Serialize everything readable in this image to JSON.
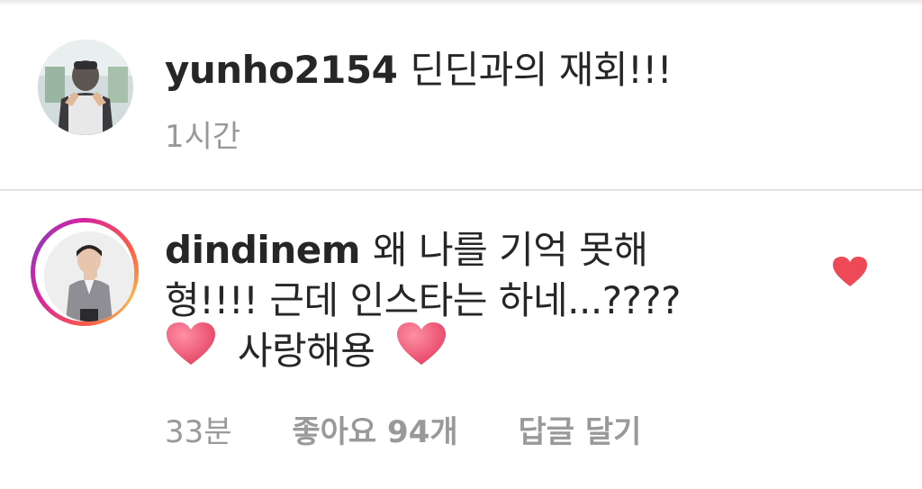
{
  "comments": [
    {
      "username": "yunho2154",
      "text": "딘딘과의 재회!!!",
      "time": "1시간"
    },
    {
      "username": "dindinem",
      "lines": [
        "왜 나를 기억 못해",
        "형!!!! 근데 인스타는 하네...????",
        "사랑해용"
      ],
      "time": "33분",
      "likes_label": "좋아요 94개",
      "reply_label": "답글 달기",
      "liked": true
    }
  ],
  "colors": {
    "text": "#262626",
    "meta": "#999999",
    "heart": "#ed4956",
    "emoji_heart": "#e84a6a"
  },
  "icons": {
    "like": "heart-filled-icon",
    "emoji": "heart-emoji-icon"
  }
}
